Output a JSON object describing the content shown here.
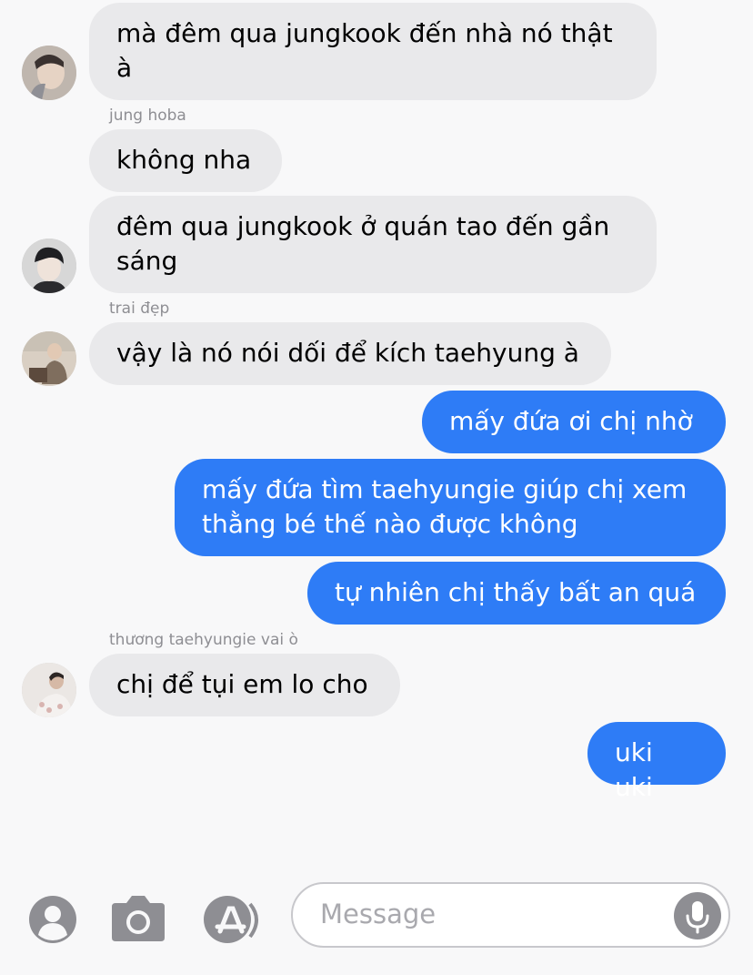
{
  "messages": [
    {
      "text": "mà đêm qua jungkook đến nhà nó thật à"
    },
    {
      "sender": "jung hoba"
    },
    {
      "text": "không nha"
    },
    {
      "text": "đêm qua jungkook ở quán tao đến gần sáng"
    },
    {
      "sender": "trai đẹp"
    },
    {
      "text": "vậy là nó nói dối để kích taehyung à"
    },
    {
      "text": "mấy đứa ơi chị nhờ"
    },
    {
      "text": "mấy đứa tìm taehyungie giúp chị xem thằng bé thế nào được không"
    },
    {
      "text": "tự nhiên chị thấy bất an quá"
    },
    {
      "sender": "thương taehyungie vai ò"
    },
    {
      "text": "chị để tụi em lo cho"
    },
    {
      "text": "uki uki"
    }
  ],
  "composer": {
    "placeholder": "Message",
    "icons": [
      "contact-icon",
      "camera-icon",
      "app-store-icon",
      "microphone-icon"
    ]
  },
  "colors": {
    "incoming_bubble": "#e9e9eb",
    "outgoing_bubble": "#2e7cf6",
    "background": "#f8f8f9",
    "sender_label": "#8e8e93"
  }
}
